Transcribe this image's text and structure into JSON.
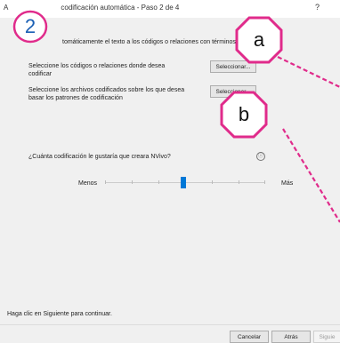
{
  "window": {
    "title_prefix": "A",
    "title": "codificación automática - Paso 2 de 4",
    "help_label": "?"
  },
  "header": {
    "text": "tomáticamente el texto a los códigos o relaciones con términos simil"
  },
  "codes_row": {
    "label_line1": "Seleccione los códigos o relaciones donde desea",
    "label_line2": "codificar",
    "button_label": "Seleccionar..."
  },
  "files_row": {
    "label_line1": "Seleccione los archivos codificados sobre los que desea",
    "label_line2": "basar los patrones de codificación",
    "button_label": "Seleccionar..."
  },
  "coding_amount": {
    "question": "¿Cuánta codificación le gustaría que creara NVivo?",
    "info_icon": "ⓘ",
    "min_label": "Menos",
    "max_label": "Más",
    "level": 0.5
  },
  "footer": {
    "hint": "Haga clic en Siguiente para continuar.",
    "cancel_label": "Cancelar",
    "back_label": "Atrás",
    "next_label": "Siguie"
  },
  "annotations": {
    "step_number": "2",
    "callout_a": "a",
    "callout_b": "b",
    "accent_color": "#e02b8b",
    "step_color": "#1a5fb4"
  }
}
